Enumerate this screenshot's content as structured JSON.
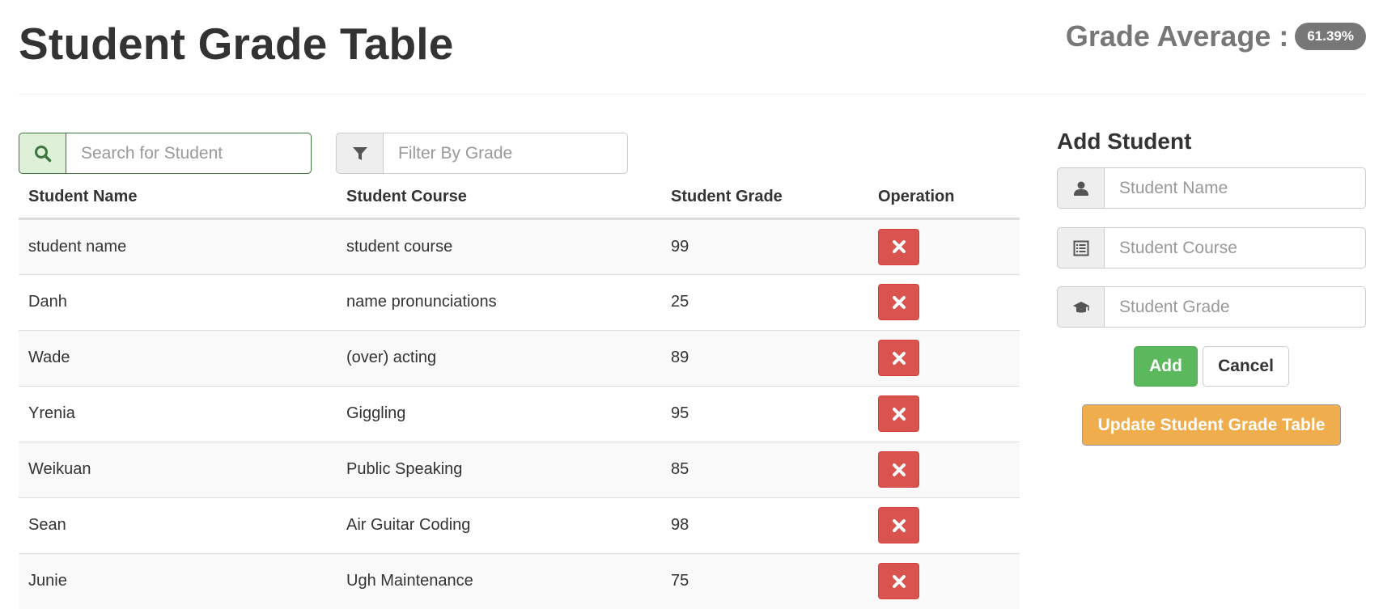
{
  "header": {
    "title": "Student Grade Table",
    "grade_average_label": "Grade Average :",
    "grade_average_value": "61.39%"
  },
  "search": {
    "placeholder": "Search for Student",
    "icon": "search-icon"
  },
  "filter": {
    "placeholder": "Filter By Grade",
    "icon": "filter-icon"
  },
  "table": {
    "columns": [
      "Student Name",
      "Student Course",
      "Student Grade",
      "Operation"
    ],
    "rows": [
      {
        "name": "student name",
        "course": "student course",
        "grade": "99"
      },
      {
        "name": "Danh",
        "course": "name pronunciations",
        "grade": "25"
      },
      {
        "name": "Wade",
        "course": "(over) acting",
        "grade": "89"
      },
      {
        "name": "Yrenia",
        "course": "Giggling",
        "grade": "95"
      },
      {
        "name": "Weikuan",
        "course": "Public Speaking",
        "grade": "85"
      },
      {
        "name": "Sean",
        "course": "Air Guitar Coding",
        "grade": "98"
      },
      {
        "name": "Junie",
        "course": "Ugh Maintenance",
        "grade": "75"
      }
    ]
  },
  "add_form": {
    "title": "Add Student",
    "name_placeholder": "Student Name",
    "course_placeholder": "Student Course",
    "grade_placeholder": "Student Grade",
    "add_label": "Add",
    "cancel_label": "Cancel",
    "update_label": "Update Student Grade Table"
  },
  "colors": {
    "danger": "#d9534f",
    "success": "#5cb85c",
    "warning": "#f0ad4e",
    "badge": "#777777",
    "search_border": "#3c763d"
  }
}
